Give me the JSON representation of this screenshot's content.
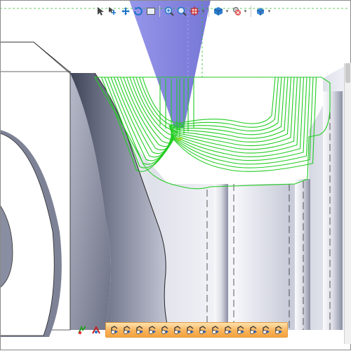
{
  "window": {
    "title": ""
  },
  "colors": {
    "toolpath": "#22cc22",
    "tool_cone": "#7f7fe0",
    "stock_light": "#eef0f6",
    "stock_shade": "#7c8096",
    "background": "#ffffff",
    "toolbar_strip": "#f8b04f"
  },
  "top_toolbar": {
    "buttons": [
      {
        "name": "select-arrow-icon",
        "has_dropdown": false
      },
      {
        "name": "multi-select-icon",
        "has_dropdown": false
      },
      {
        "name": "move-icon",
        "has_dropdown": false
      },
      {
        "name": "rotate-view-icon",
        "has_dropdown": false
      },
      {
        "name": "box-select-icon",
        "has_dropdown": false
      },
      {
        "name": "zoom-in-icon",
        "has_dropdown": false
      },
      {
        "name": "zoom-fit-icon",
        "has_dropdown": false
      },
      {
        "name": "pan-icon",
        "has_dropdown": true
      },
      {
        "name": "cube-view-icon",
        "has_dropdown": true
      },
      {
        "name": "display-settings-icon",
        "has_dropdown": true
      },
      {
        "name": "shading-icon",
        "has_dropdown": true
      }
    ]
  },
  "bottom_toolbar": {
    "left_buttons": [
      "simulate-play-icon",
      "simulate-cut-icon"
    ],
    "strip_buttons": [
      "rewind-start-icon",
      "step-back-icon",
      "play-back-icon",
      "prev-move-icon",
      "stop-icon",
      "next-move-icon",
      "play-icon",
      "step-forward-icon",
      "fast-forward-icon",
      "end-icon",
      "tool-display-icon",
      "toolpath-display-icon",
      "stock-display-icon",
      "settings-icon"
    ]
  }
}
